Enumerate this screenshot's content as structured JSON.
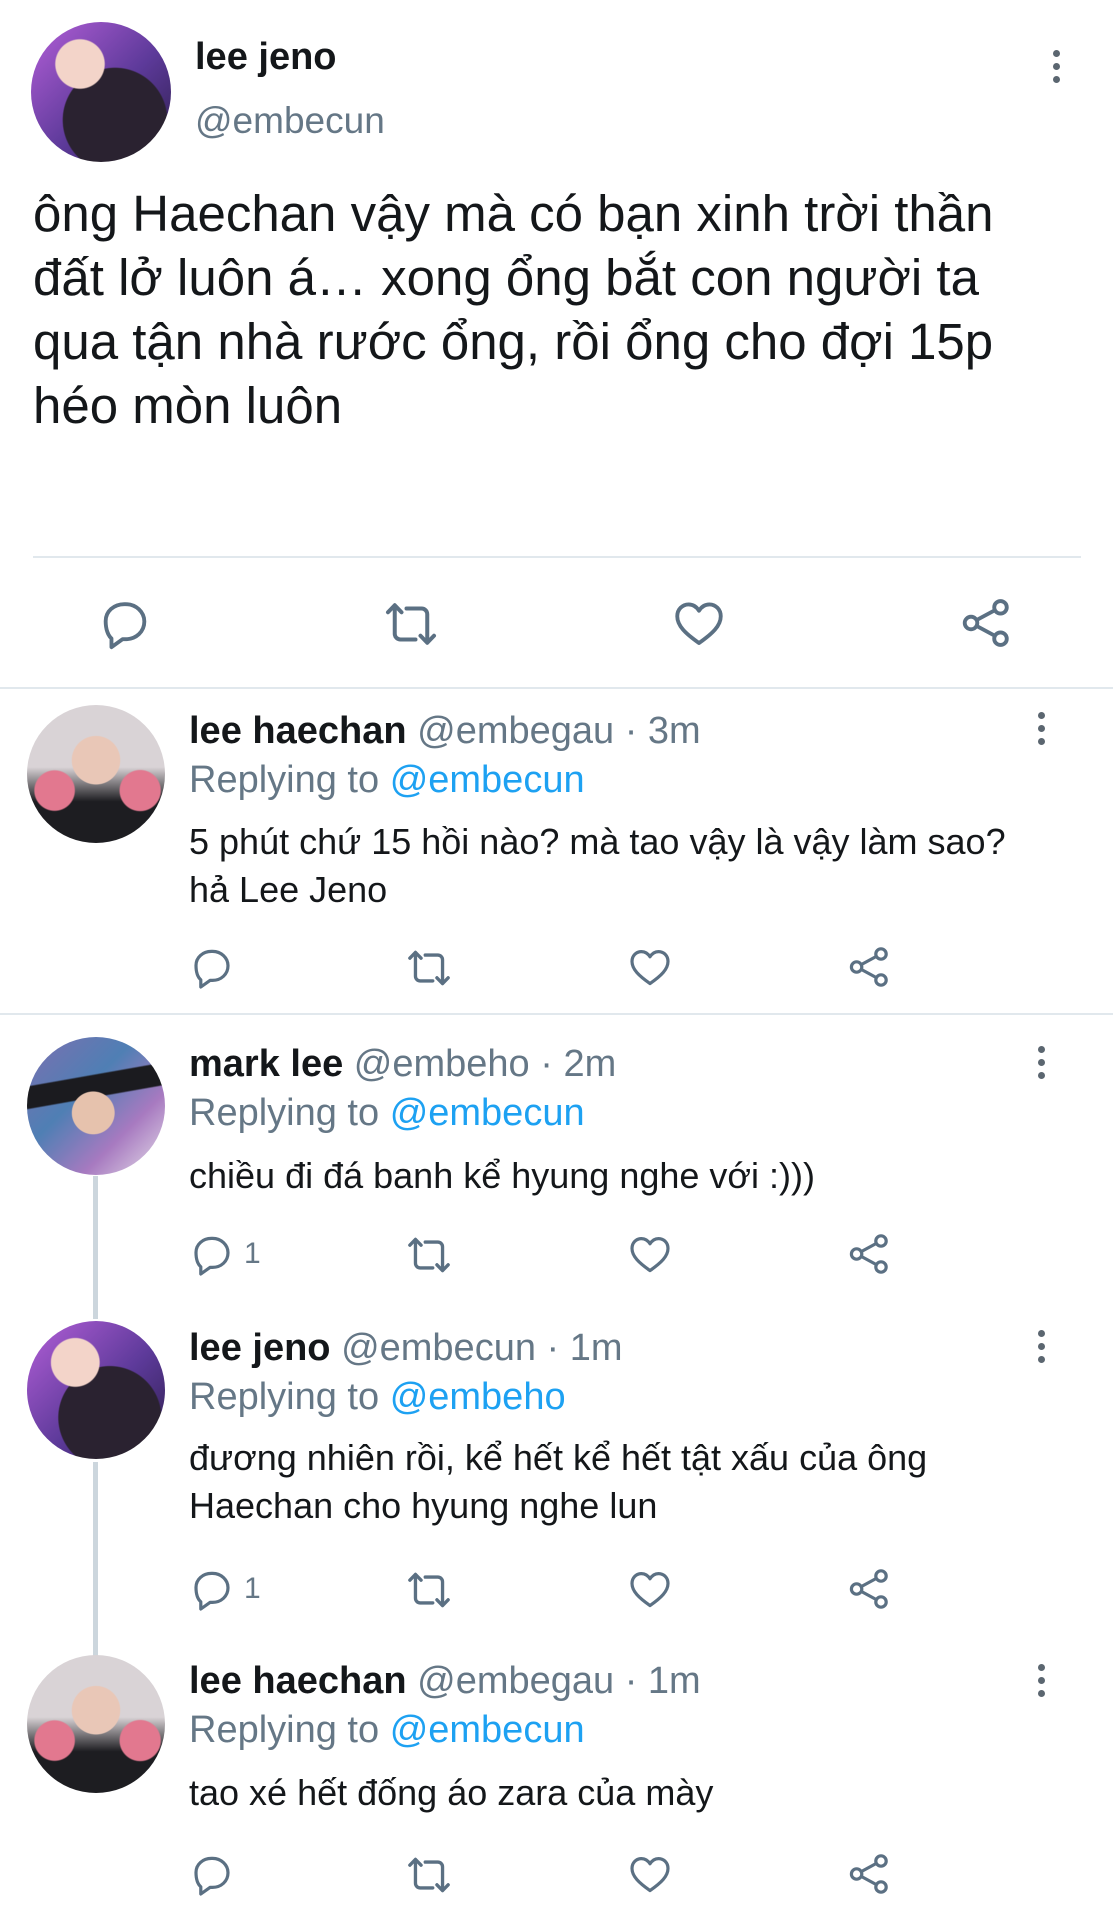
{
  "main_tweet": {
    "author_name": "lee jeno",
    "author_handle": "@embecun",
    "text": "ông Haechan vậy mà có bạn xinh trời thần đất lở luôn á… xong ổng bắt con người ta qua tận nhà rước ổng, rồi ổng cho đợi 15p héo mòn luôn",
    "icons": [
      "reply-icon",
      "retweet-icon",
      "like-icon",
      "share-icon"
    ]
  },
  "replies": [
    {
      "author_name": "lee haechan",
      "meta": "@embegau · 3m",
      "replying_label": "Replying to",
      "replying_to": "@embecun",
      "text": "5 phút chứ 15 hồi nào? mà tao vậy là vậy làm sao? hả Lee Jeno",
      "reply_count": ""
    },
    {
      "author_name": "mark lee",
      "meta": "@embeho · 2m",
      "replying_label": "Replying to",
      "replying_to": "@embecun",
      "text": "chiều đi đá banh kể hyung nghe với :)))",
      "reply_count": "1"
    },
    {
      "author_name": "lee jeno",
      "meta": "@embecun · 1m",
      "replying_label": "Replying to",
      "replying_to": "@embeho",
      "text": "đương nhiên rồi, kể hết kể hết tật xấu của ông Haechan cho hyung nghe lun",
      "reply_count": "1"
    },
    {
      "author_name": "lee haechan",
      "meta": "@embegau · 1m",
      "replying_label": "Replying to",
      "replying_to": "@embecun",
      "text": "tao xé hết đống áo zara của mày",
      "reply_count": ""
    }
  ],
  "colors": {
    "text": "#14171a",
    "secondary": "#657786",
    "mention": "#1da1f2",
    "divider": "#e1e8ed",
    "thread_line": "#ccd6dd",
    "icon": "#5b7083"
  }
}
